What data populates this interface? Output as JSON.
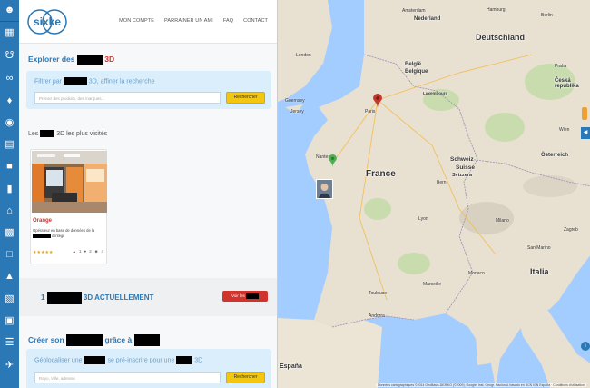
{
  "header": {
    "logo_text": "sixke",
    "nav": [
      "MON COMPTE",
      "PARRAINER UN AMI",
      "FAQ",
      "CONTACT"
    ]
  },
  "explore": {
    "title_prefix": "Explorer des",
    "title_suffix": "3D",
    "filter_prefix": "Filtrer par",
    "filter_suffix": "3D, affiner la recherche",
    "search_placeholder": "Prenez des produits, des marques...",
    "search_button": "Rechercher"
  },
  "visited": {
    "label_prefix": "Les",
    "label_suffix": "3D les plus visités",
    "card": {
      "title": "Orange",
      "description": "Opérateur en base de données de la",
      "description_tail": "d'intégr",
      "stars": "★★★★★",
      "views": "1",
      "comments": "2",
      "users": "4"
    }
  },
  "counter": {
    "prefix": "1",
    "suffix": "3D ACTUELLEMENT",
    "button": "Voir les"
  },
  "create": {
    "title_prefix": "Créer son",
    "title_middle": "grâce à",
    "geo_prefix": "Géolocaliser une",
    "geo_middle": "se pré-inscrire pour une",
    "geo_suffix": "3D",
    "geo_placeholder": "Rayo, Ville, adresse",
    "geo_button": "Rechercher"
  },
  "map": {
    "countries": [
      "Nederland",
      "Deutschland",
      "België",
      "Belgique",
      "Luxembourg",
      "France",
      "Schweiz",
      "Suisse",
      "Svizzera",
      "Österreich",
      "Česká republika",
      "Italia",
      "España"
    ],
    "cities": [
      "Hamburg",
      "Amsterdam",
      "London",
      "Berlin",
      "Paris",
      "Guernsey",
      "Jersey",
      "Nantes",
      "Lyon",
      "Milano",
      "Marseille",
      "Toulouse",
      "Monaco",
      "Andorra",
      "Zagreb",
      "San Marino",
      "Praha",
      "Wien",
      "Bern"
    ],
    "attribution": "Données cartographiques ©2014 GeoBasis-DE/BKG (©2009), Google, Inst. Geogr. Nacional, basado en BCN IGN España · Conditions d'utilisation",
    "colors": {
      "sea": "#a3ccff",
      "land": "#e8e0d0",
      "forest": "#c8dcae",
      "marker_red": "#c0392b",
      "marker_green": "#4caf50"
    }
  },
  "rail_icons": [
    "user-icon",
    "grid-icon",
    "cart-icon",
    "binoculars-icon",
    "tag-icon",
    "globe-icon",
    "book-icon",
    "puzzle-icon",
    "bag-icon",
    "home-icon",
    "building-icon",
    "factory-icon",
    "graduation-icon",
    "chart-icon",
    "shop-icon",
    "layers-icon",
    "plane-icon"
  ]
}
